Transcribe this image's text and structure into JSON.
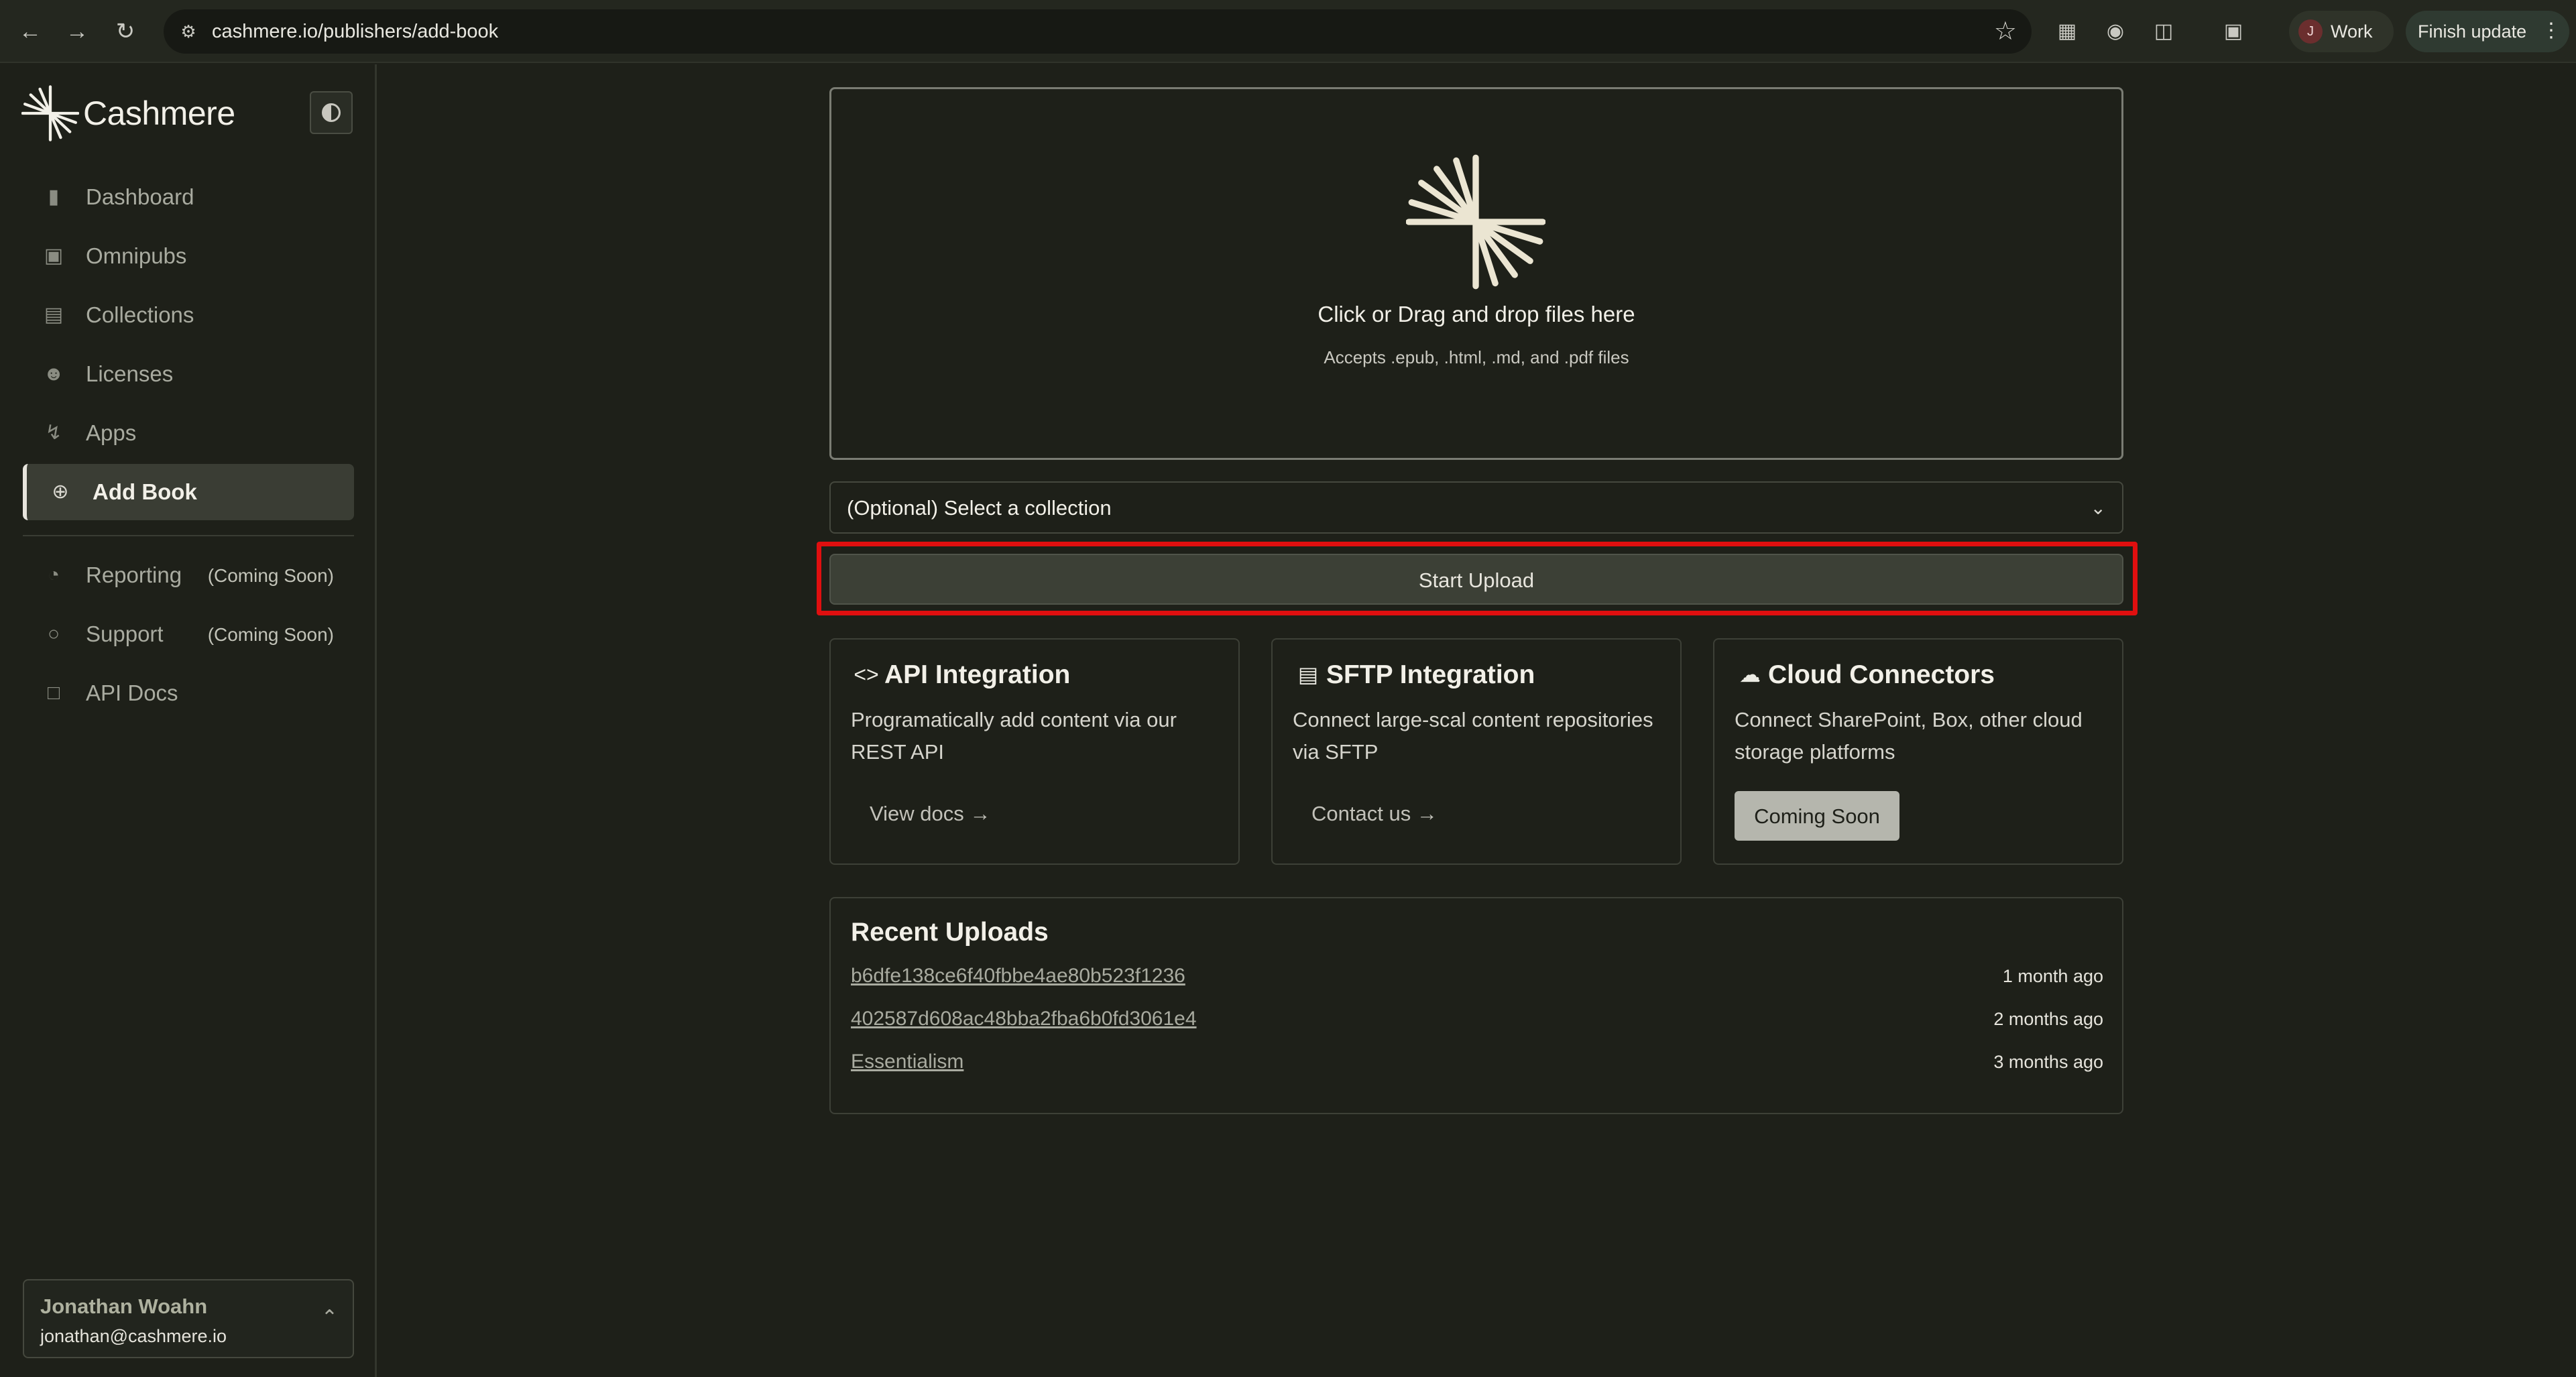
{
  "browser": {
    "url": "cashmere.io/publishers/add-book",
    "profile_initial": "J",
    "profile_label": "Work",
    "update_label": "Finish update"
  },
  "sidebar": {
    "logo_text": "Cashmere",
    "items": [
      {
        "label": "Dashboard",
        "icon": "bar-chart-icon"
      },
      {
        "label": "Omnipubs",
        "icon": "book-open-icon"
      },
      {
        "label": "Collections",
        "icon": "stack-icon"
      },
      {
        "label": "Licenses",
        "icon": "users-icon"
      },
      {
        "label": "Apps",
        "icon": "bolt-icon"
      },
      {
        "label": "Add Book",
        "icon": "plus-circle-icon",
        "active": true
      },
      {
        "label": "Reporting",
        "icon": "pie-chart-icon",
        "tag": "(Coming Soon)"
      },
      {
        "label": "Support",
        "icon": "chat-bubble-icon",
        "tag": "(Coming Soon)"
      },
      {
        "label": "API Docs",
        "icon": "document-icon"
      }
    ],
    "user": {
      "name": "Jonathan Woahn",
      "email": "jonathan@cashmere.io"
    }
  },
  "main": {
    "dropzone": {
      "title": "Click or Drag and drop files here",
      "subtitle": "Accepts .epub, .html, .md, and .pdf files"
    },
    "collection_select": {
      "value": "(Optional) Select a collection"
    },
    "start_upload_label": "Start Upload",
    "cards": [
      {
        "title": "API Integration",
        "icon": "code-icon",
        "description": "Programatically add content via our REST API",
        "link": "View docs →"
      },
      {
        "title": "SFTP Integration",
        "icon": "server-icon",
        "description": "Connect large-scal content repositories via SFTP",
        "link": "Contact us →"
      },
      {
        "title": "Cloud Connectors",
        "icon": "cloud-icon",
        "description": "Connect SharePoint, Box, other cloud storage platforms",
        "button": "Coming Soon"
      }
    ],
    "recent_uploads": {
      "title": "Recent Uploads",
      "rows": [
        {
          "name": "b6dfe138ce6f40fbbe4ae80b523f1236",
          "time": "1 month ago"
        },
        {
          "name": "402587d608ac48bba2fba6b0fd3061e4",
          "time": "2 months ago"
        },
        {
          "name": "Essentialism",
          "time": "3 months ago"
        }
      ]
    }
  },
  "colors": {
    "background": "#1e2019",
    "highlight": "#e00f0f",
    "button": "#3c4036",
    "accent_text": "#f2f0e8"
  }
}
